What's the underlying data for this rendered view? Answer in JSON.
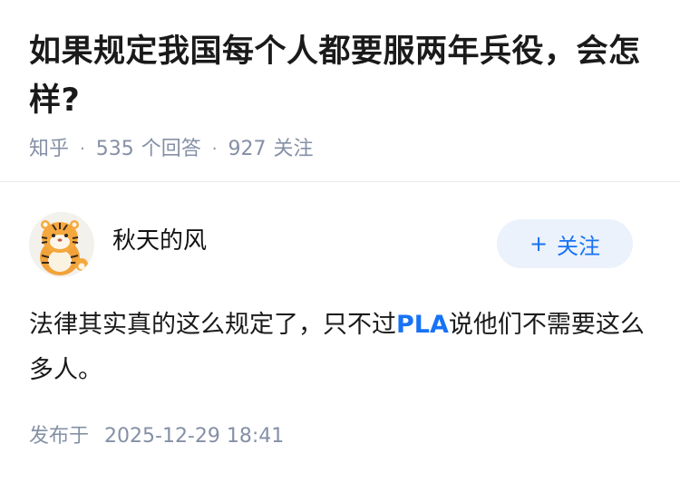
{
  "question": {
    "title": "如果规定我国每个人都要服两年兵役，会怎样?",
    "source": "知乎",
    "answer_count": "535",
    "answer_label": "个回答",
    "follower_count": "927",
    "follower_label": "关注"
  },
  "answer": {
    "author": {
      "name": "秋天的风",
      "avatar_icon": "tiger-avatar-icon"
    },
    "follow_button": {
      "icon": "plus-icon",
      "label": "关注"
    },
    "content_before": "法律其实真的这么规定了，只不过",
    "content_highlight": "PLA",
    "content_after": "说他们不需要这么多人。",
    "publish_label": "发布于",
    "publish_time": "2025-12-29 18:41"
  },
  "colors": {
    "accent": "#1772f6",
    "meta": "#8590a6",
    "button_bg": "#ebf2fb"
  }
}
